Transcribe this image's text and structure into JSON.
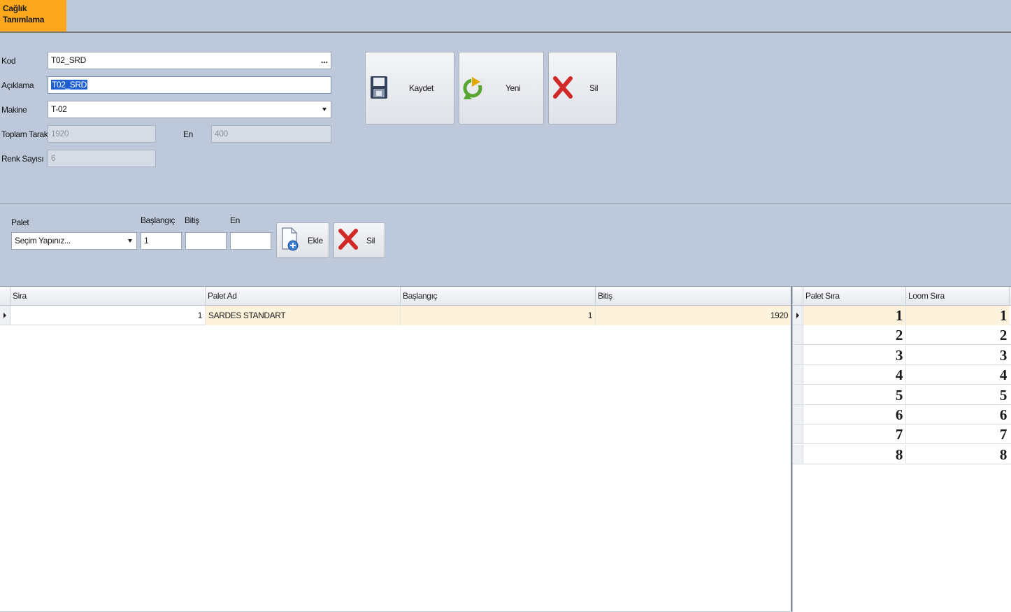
{
  "tab": {
    "line1": "Cağlık",
    "line2": "Tanımlama"
  },
  "form": {
    "kod_label": "Kod",
    "kod_value": "T02_SRD",
    "kod_button": "...",
    "aciklama_label": "Açıklama",
    "aciklama_value": "T02_SRD",
    "makine_label": "Makine",
    "makine_value": "T-02",
    "toplam_tarak_label": "Toplam Tarak",
    "toplam_tarak_value": "1920",
    "en_label": "En",
    "en_value": "400",
    "renk_sayisi_label": "Renk Sayısı",
    "renk_sayisi_value": "6"
  },
  "actions": {
    "kaydet": "Kaydet",
    "yeni": "Yeni",
    "sil": "Sil"
  },
  "palet_section": {
    "palet_label": "Palet",
    "palet_value": "Seçim Yapınız...",
    "baslangic_label": "Başlangıç",
    "baslangic_value": "1",
    "bitis_label": "Bitiş",
    "bitis_value": "",
    "en_label": "En",
    "en_value": "",
    "ekle": "Ekle",
    "sil": "Sil"
  },
  "main_grid": {
    "columns": [
      "Sira",
      "Palet Ad",
      "Başlangıç",
      "Bitiş"
    ],
    "rows": [
      {
        "sira": "1",
        "palet_ad": "SARDES STANDART",
        "baslangic": "1",
        "bitis": "1920"
      }
    ]
  },
  "side_grid": {
    "columns": [
      "Palet Sıra",
      "Loom Sıra"
    ],
    "rows": [
      {
        "palet_sira": "1",
        "loom_sira": "1"
      },
      {
        "palet_sira": "2",
        "loom_sira": "2"
      },
      {
        "palet_sira": "3",
        "loom_sira": "3"
      },
      {
        "palet_sira": "4",
        "loom_sira": "4"
      },
      {
        "palet_sira": "5",
        "loom_sira": "5"
      },
      {
        "palet_sira": "6",
        "loom_sira": "6"
      },
      {
        "palet_sira": "7",
        "loom_sira": "7"
      },
      {
        "palet_sira": "8",
        "loom_sira": "8"
      }
    ]
  },
  "colors": {
    "tab": "#fca81c",
    "background": "#bdc9db",
    "selected_row": "#fdf3dc",
    "selection": "#1e5fd6"
  }
}
